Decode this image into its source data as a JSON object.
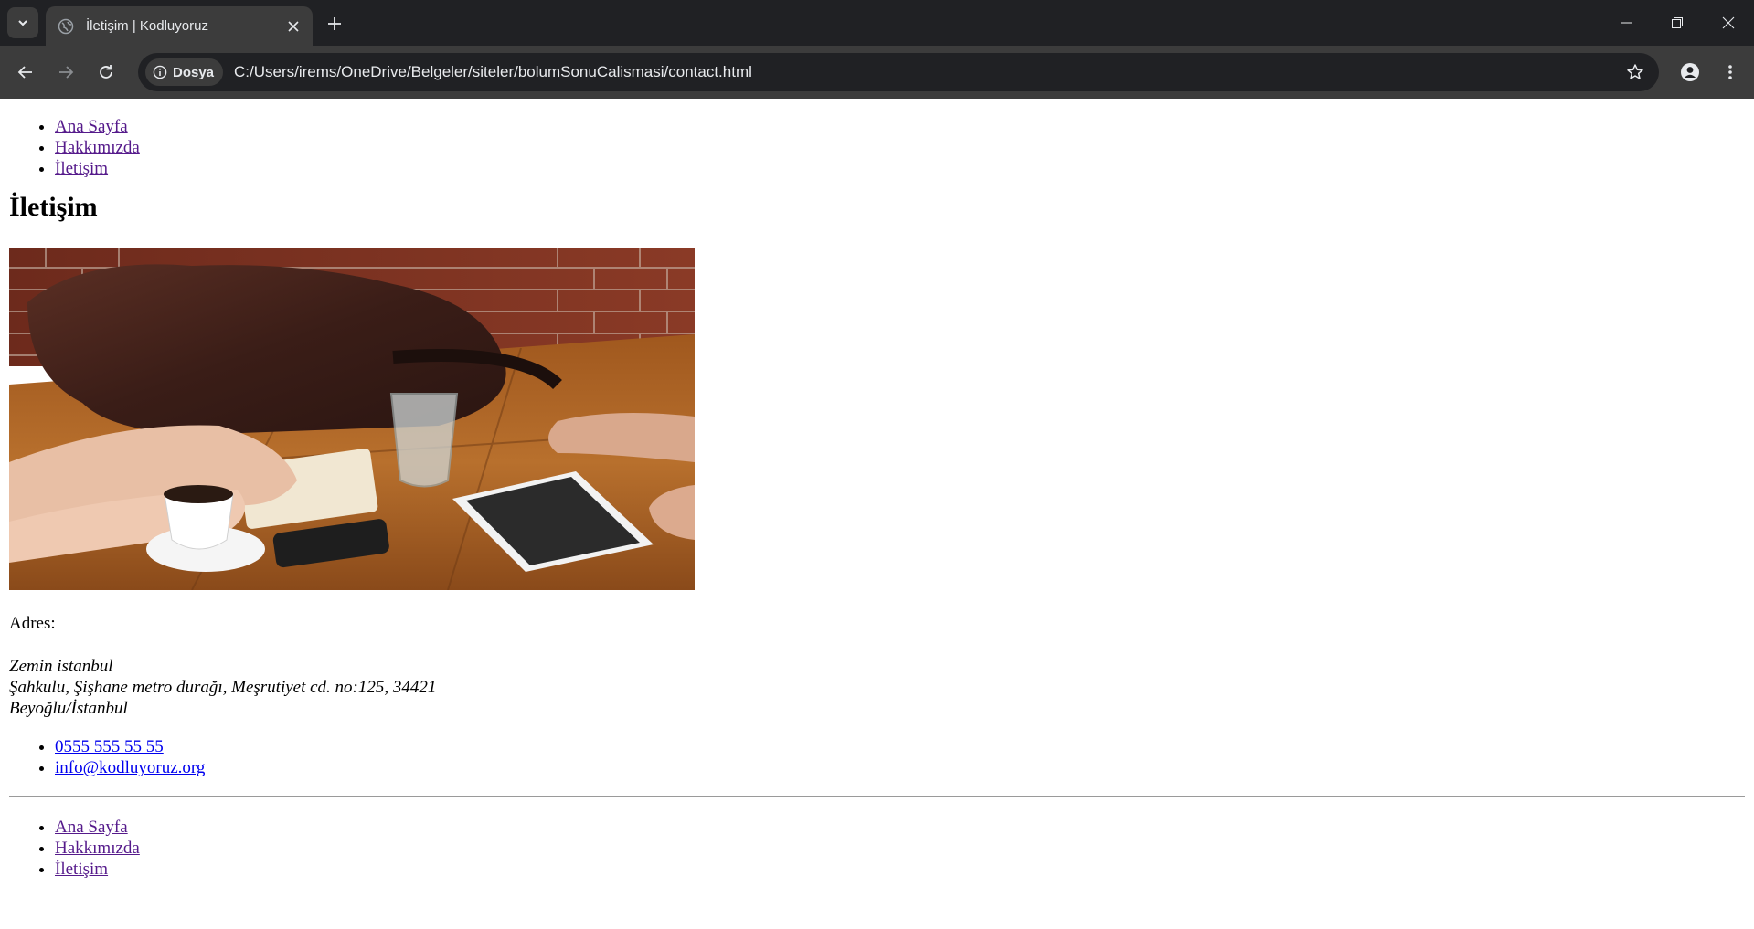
{
  "browser": {
    "tab_title": "İletişim | Kodluyoruz",
    "site_chip_label": "Dosya",
    "url": "C:/Users/irems/OneDrive/Belgeler/siteler/bolumSonuCalismasi/contact.html",
    "icons": [
      "tab-search-icon",
      "globe-icon",
      "close-icon",
      "plus-icon",
      "minimize-icon",
      "restore-icon",
      "close-window-icon",
      "back-arrow-icon",
      "forward-arrow-icon",
      "reload-icon",
      "info-icon",
      "star-icon",
      "profile-icon",
      "kebab-menu-icon"
    ],
    "colors": {
      "tabstrip": "#202124",
      "toolbar": "#3c3c3c",
      "omnibox": "#202124",
      "text": "#e8eaed"
    }
  },
  "nav": [
    {
      "label": "Ana Sayfa"
    },
    {
      "label": "Hakkımızda"
    },
    {
      "label": "İletişim"
    }
  ],
  "heading": "İletişim",
  "address_label": "Adres:",
  "address_lines": [
    "Zemin istanbul",
    "Şahkulu, Şişhane metro durağı, Meşrutiyet cd. no:125, 34421",
    "Beyoğlu/İstanbul"
  ],
  "contacts": [
    {
      "label": "0555 555 55 55"
    },
    {
      "label": "info@kodluyoruz.org"
    }
  ],
  "footer_nav": [
    {
      "label": "Ana Sayfa"
    },
    {
      "label": "Hakkımızda"
    },
    {
      "label": "İletişim"
    }
  ],
  "link_colors": {
    "visited": "#551a8b",
    "unvisited": "#0000ee"
  }
}
